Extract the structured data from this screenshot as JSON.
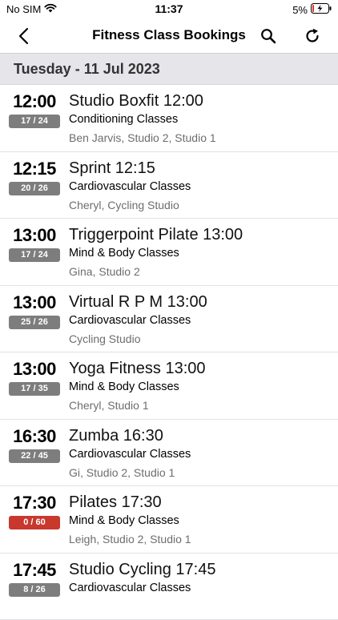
{
  "status": {
    "carrier": "No SIM",
    "time": "11:37",
    "battery": "5%"
  },
  "nav": {
    "title": "Fitness Class Bookings"
  },
  "date_header": "Tuesday - 11 Jul 2023",
  "colors": {
    "capacity_normal": "#7d7d7d",
    "capacity_empty": "#c8382d"
  },
  "classes": [
    {
      "time": "12:00",
      "capacity": "17 / 24",
      "name": "Studio Boxfit 12:00",
      "category": "Conditioning Classes",
      "location": "Ben Jarvis, Studio 2, Studio 1",
      "status": "normal"
    },
    {
      "time": "12:15",
      "capacity": "20 / 26",
      "name": "Sprint 12:15",
      "category": "Cardiovascular Classes",
      "location": "Cheryl, Cycling Studio",
      "status": "normal"
    },
    {
      "time": "13:00",
      "capacity": "17 / 24",
      "name": "Triggerpoint Pilate 13:00",
      "category": "Mind & Body Classes",
      "location": "Gina, Studio 2",
      "status": "normal"
    },
    {
      "time": "13:00",
      "capacity": "25 / 26",
      "name": "Virtual R P M 13:00",
      "category": "Cardiovascular Classes",
      "location": "Cycling Studio",
      "status": "normal"
    },
    {
      "time": "13:00",
      "capacity": "17 / 35",
      "name": "Yoga Fitness 13:00",
      "category": "Mind & Body Classes",
      "location": "Cheryl, Studio 1",
      "status": "normal"
    },
    {
      "time": "16:30",
      "capacity": "22 / 45",
      "name": "Zumba 16:30",
      "category": "Cardiovascular Classes",
      "location": "Gi, Studio 2, Studio 1",
      "status": "normal"
    },
    {
      "time": "17:30",
      "capacity": "0 / 60",
      "name": "Pilates 17:30",
      "category": "Mind & Body Classes",
      "location": "Leigh, Studio 2, Studio 1",
      "status": "empty"
    },
    {
      "time": "17:45",
      "capacity": "8 / 26",
      "name": "Studio Cycling 17:45",
      "category": "Cardiovascular Classes",
      "location": "",
      "status": "normal"
    }
  ]
}
